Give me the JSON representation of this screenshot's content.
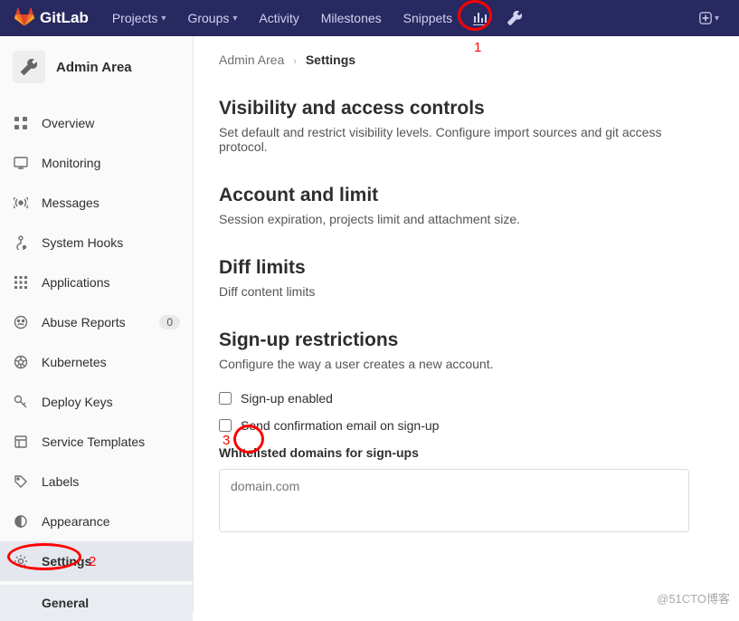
{
  "header": {
    "brand": "GitLab",
    "nav": [
      {
        "label": "Projects",
        "caret": true
      },
      {
        "label": "Groups",
        "caret": true
      },
      {
        "label": "Activity",
        "caret": false
      },
      {
        "label": "Milestones",
        "caret": false
      },
      {
        "label": "Snippets",
        "caret": false
      }
    ]
  },
  "sidebar": {
    "title": "Admin Area",
    "items": [
      {
        "label": "Overview",
        "icon": "overview"
      },
      {
        "label": "Monitoring",
        "icon": "monitoring"
      },
      {
        "label": "Messages",
        "icon": "messages"
      },
      {
        "label": "System Hooks",
        "icon": "hooks"
      },
      {
        "label": "Applications",
        "icon": "apps"
      },
      {
        "label": "Abuse Reports",
        "icon": "abuse",
        "badge": "0"
      },
      {
        "label": "Kubernetes",
        "icon": "kube"
      },
      {
        "label": "Deploy Keys",
        "icon": "key"
      },
      {
        "label": "Service Templates",
        "icon": "template"
      },
      {
        "label": "Labels",
        "icon": "labels"
      },
      {
        "label": "Appearance",
        "icon": "appearance"
      },
      {
        "label": "Settings",
        "icon": "settings"
      }
    ],
    "sub_active": "General"
  },
  "breadcrumbs": {
    "root": "Admin Area",
    "current": "Settings"
  },
  "sections": {
    "visibility": {
      "title": "Visibility and access controls",
      "desc": "Set default and restrict visibility levels. Configure import sources and git access protocol."
    },
    "account": {
      "title": "Account and limit",
      "desc": "Session expiration, projects limit and attachment size."
    },
    "diff": {
      "title": "Diff limits",
      "desc": "Diff content limits"
    },
    "signup": {
      "title": "Sign-up restrictions",
      "desc": "Configure the way a user creates a new account.",
      "chk1": "Sign-up enabled",
      "chk2": "Send confirmation email on sign-up",
      "whitelist_label": "Whitelisted domains for sign-ups",
      "whitelist_placeholder": "domain.com"
    }
  },
  "annotations": {
    "a1": "1",
    "a2": "2",
    "a3": "3"
  },
  "watermark": "@51CTO博客"
}
